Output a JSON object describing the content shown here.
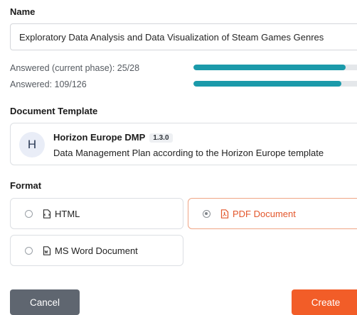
{
  "name_section": {
    "label": "Name",
    "value": "Exploratory Data Analysis and Data Visualization of Steam Games Genres"
  },
  "progress": [
    {
      "label": "Answered (current phase): 25/28",
      "fraction": 0.893
    },
    {
      "label": "Answered: 109/126",
      "fraction": 0.865
    }
  ],
  "template_section": {
    "label": "Document Template",
    "avatar_letter": "H",
    "name": "Horizon Europe DMP",
    "version": "1.3.0",
    "description": "Data Management Plan according to the Horizon Europe template"
  },
  "format_section": {
    "label": "Format",
    "options": [
      {
        "label": "HTML",
        "icon": "html-file-icon",
        "selected": false
      },
      {
        "label": "PDF Document",
        "icon": "pdf-file-icon",
        "selected": true
      },
      {
        "label": "MS Word Document",
        "icon": "word-file-icon",
        "selected": false
      }
    ]
  },
  "actions": {
    "cancel_label": "Cancel",
    "create_label": "Create"
  },
  "colors": {
    "progress_fill": "#1b9aaa",
    "accent": "#f25d28",
    "cancel": "#5f6670"
  }
}
